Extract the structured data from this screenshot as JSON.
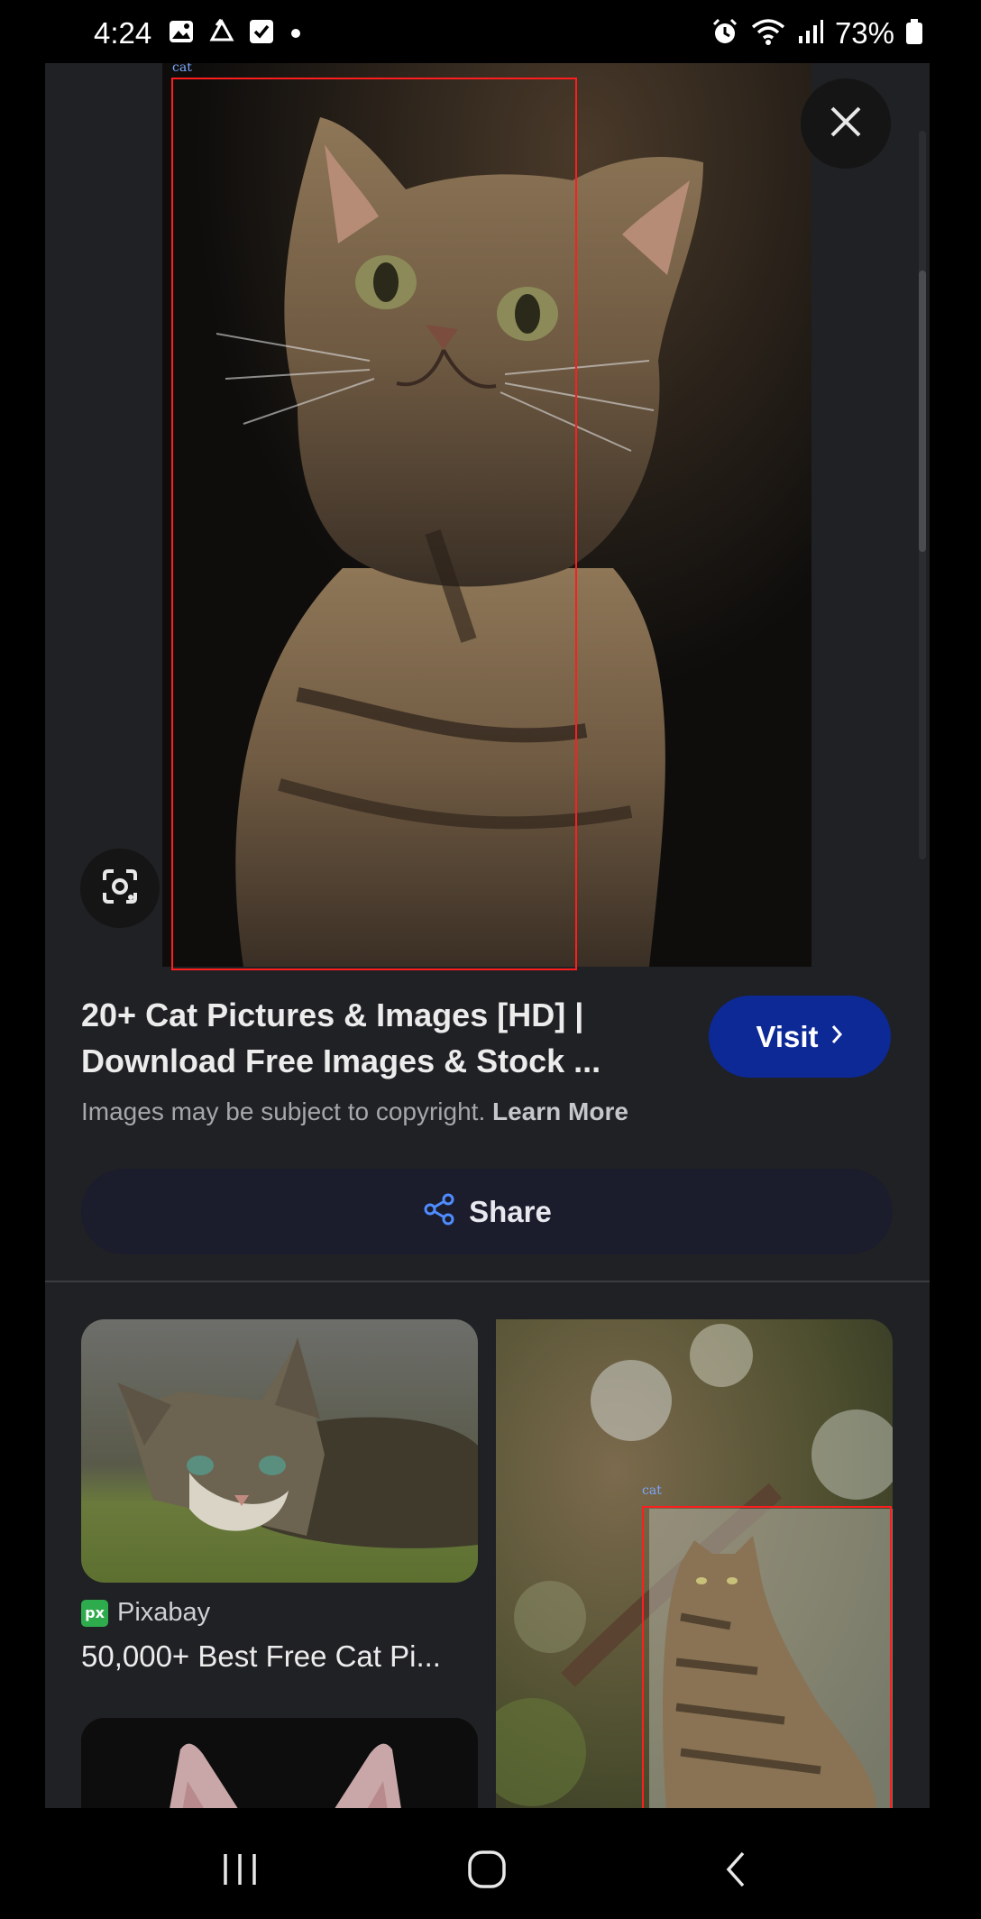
{
  "status_bar": {
    "time": "4:24",
    "battery_percent": "73%",
    "left_icons": [
      "gallery-icon",
      "recycle-icon",
      "checkbox-icon",
      "dot-icon"
    ],
    "right_icons": [
      "alarm-icon",
      "wifi-icon",
      "signal-icon",
      "battery-icon"
    ]
  },
  "viewer": {
    "detection_label": "cat",
    "close_icon": "close-icon",
    "lens_icon": "lens-icon"
  },
  "result": {
    "title_line1": "20+ Cat Pictures & Images [HD] |",
    "title_line2": "Download Free Images & Stock ...",
    "visit_label": "Visit",
    "copyright_text": "Images may be subject to copyright.",
    "learn_more_label": "Learn More",
    "share_label": "Share"
  },
  "related": [
    {
      "source_badge": "px",
      "source": "Pixabay",
      "title": "50,000+ Best Free Cat Pi..."
    },
    {
      "detection_label": "cat"
    }
  ],
  "nav_bar": {
    "icons": [
      "recents-icon",
      "home-icon",
      "back-icon"
    ]
  },
  "colors": {
    "visit_button": "#0c2996",
    "share_button": "#1b1c2c",
    "share_icon": "#4f8cff",
    "detection_box": "#ff1d1d",
    "pixabay_badge": "#2eab4d"
  }
}
